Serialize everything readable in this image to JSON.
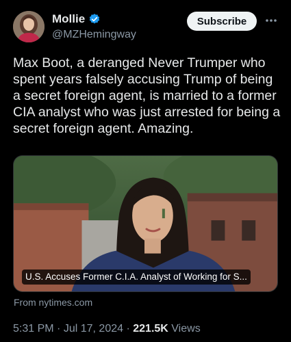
{
  "author": {
    "display_name": "Mollie",
    "handle": "@MZHemingway",
    "verified_icon": "verified-badge-icon",
    "avatar_icon": "avatar"
  },
  "actions": {
    "subscribe_label": "Subscribe",
    "more_icon": "more-icon"
  },
  "tweet": {
    "text": "Max Boot, a deranged Never Trumper who spent years falsely accusing Trump of being a secret foreign agent, is married to a former CIA analyst who was just arrested for being a secret foreign agent. Amazing."
  },
  "link_card": {
    "title": "U.S. Accuses Former C.I.A. Analyst of Working for S...",
    "source": "From nytimes.com"
  },
  "meta": {
    "time": "5:31 PM",
    "separator": "·",
    "date": "Jul 17, 2024",
    "views_count": "221.5K",
    "views_label": "Views"
  },
  "colors": {
    "background": "#000000",
    "text_primary": "#e7e9ea",
    "text_secondary": "#8b98a5",
    "verified": "#1d9bf0",
    "subscribe_bg": "#eff3f4"
  }
}
